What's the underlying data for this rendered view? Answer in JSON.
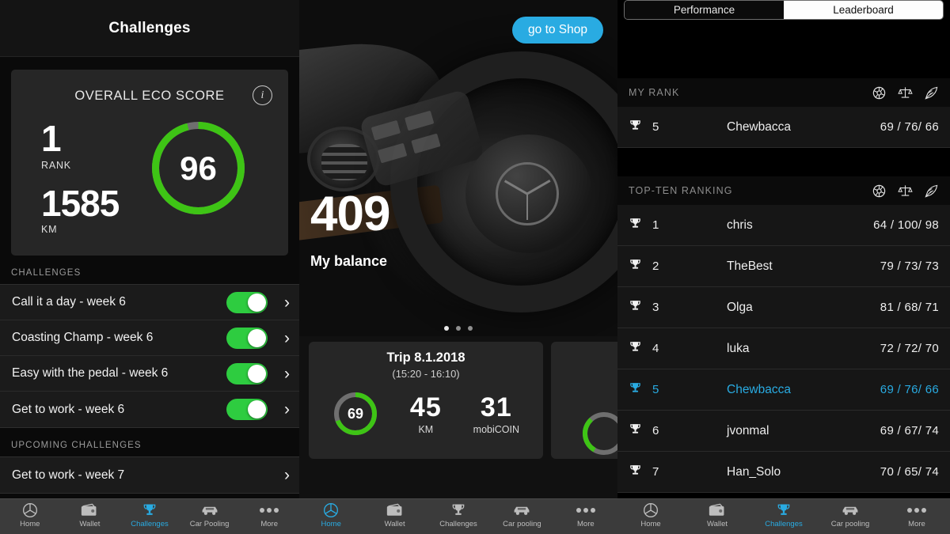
{
  "left_panel": {
    "header_title": "Challenges",
    "eco_card": {
      "title": "OVERALL ECO SCORE",
      "info_icon": "info-icon",
      "rank_value": "1",
      "rank_label": "RANK",
      "km_value": "1585",
      "km_label": "KM",
      "score_value": "96",
      "score_percent": 96,
      "ring_color": "#3ec415",
      "ring_track_color": "#6f6f6f"
    },
    "challenges_section_label": "CHALLENGES",
    "challenges": [
      {
        "name": "Call it a day - week 6",
        "toggle_on": true,
        "chevron": "›"
      },
      {
        "name": "Coasting Champ - week 6",
        "toggle_on": true,
        "chevron": "›"
      },
      {
        "name": "Easy with the pedal - week 6",
        "toggle_on": true,
        "chevron": "›"
      },
      {
        "name": "Get to work - week 6",
        "toggle_on": true,
        "chevron": "›"
      }
    ],
    "upcoming_section_label": "UPCOMING CHALLENGES",
    "upcoming": [
      {
        "name": "Get to work - week 7",
        "chevron": "›"
      }
    ],
    "tabbar": [
      {
        "label": "Home",
        "icon": "mercedes-star-icon",
        "active": false
      },
      {
        "label": "Wallet",
        "icon": "wallet-icon",
        "active": false
      },
      {
        "label": "Challenges",
        "icon": "trophy-icon",
        "active": true
      },
      {
        "label": "Car Pooling",
        "icon": "car-icon",
        "active": false
      },
      {
        "label": "More",
        "icon": "ellipsis-icon",
        "active": false
      }
    ]
  },
  "mid_panel": {
    "shop_button": "go to Shop",
    "balance_value": "409",
    "balance_label": "My balance",
    "page_dots": 3,
    "active_dot": 0,
    "trip_card": {
      "title": "Trip 8.1.2018",
      "subtitle": "(15:20 - 16:10)",
      "score_value": "69",
      "score_percent": 69,
      "km_value": "45",
      "km_label": "KM",
      "coin_value": "31",
      "coin_label": "mobiCOIN"
    },
    "tabbar": [
      {
        "label": "Home",
        "icon": "mercedes-star-icon",
        "active": true
      },
      {
        "label": "Wallet",
        "icon": "wallet-icon",
        "active": false
      },
      {
        "label": "Challenges",
        "icon": "trophy-icon",
        "active": false
      },
      {
        "label": "Car pooling",
        "icon": "car-icon",
        "active": false
      },
      {
        "label": "More",
        "icon": "ellipsis-icon",
        "active": false
      }
    ]
  },
  "right_panel": {
    "tabs": {
      "performance": "Performance",
      "leaderboard": "Leaderboard",
      "selected": "Leaderboard"
    },
    "my_rank_label": "MY RANK",
    "my_rank_row": {
      "position": "5",
      "name": "Chewbacca",
      "score": "69 / 76/ 66",
      "highlight": true
    },
    "top_ten_label": "TOP-TEN RANKING",
    "column_icons": [
      "tire-icon",
      "balance-scale-icon",
      "feather-icon"
    ],
    "ranking": [
      {
        "position": "1",
        "name": "chris",
        "score": "64 / 100/ 98",
        "highlight": false
      },
      {
        "position": "2",
        "name": "TheBest",
        "score": "79 / 73/ 73",
        "highlight": false
      },
      {
        "position": "3",
        "name": "Olga",
        "score": "81 / 68/ 71",
        "highlight": false
      },
      {
        "position": "4",
        "name": "luka",
        "score": "72 / 72/ 70",
        "highlight": false
      },
      {
        "position": "5",
        "name": "Chewbacca",
        "score": "69 / 76/ 66",
        "highlight": true
      },
      {
        "position": "6",
        "name": "jvonmal",
        "score": "69 / 67/ 74",
        "highlight": false
      },
      {
        "position": "7",
        "name": "Han_Solo",
        "score": "70 / 65/ 74",
        "highlight": false
      }
    ],
    "tabbar": [
      {
        "label": "Home",
        "icon": "mercedes-star-icon",
        "active": false
      },
      {
        "label": "Wallet",
        "icon": "wallet-icon",
        "active": false
      },
      {
        "label": "Challenges",
        "icon": "trophy-icon",
        "active": true
      },
      {
        "label": "Car pooling",
        "icon": "car-icon",
        "active": false
      },
      {
        "label": "More",
        "icon": "ellipsis-icon",
        "active": false
      }
    ]
  },
  "theme": {
    "accent_blue": "#29abe2",
    "accent_green": "#2ecc40",
    "ring_green": "#3ec415",
    "bg": "#000000"
  }
}
